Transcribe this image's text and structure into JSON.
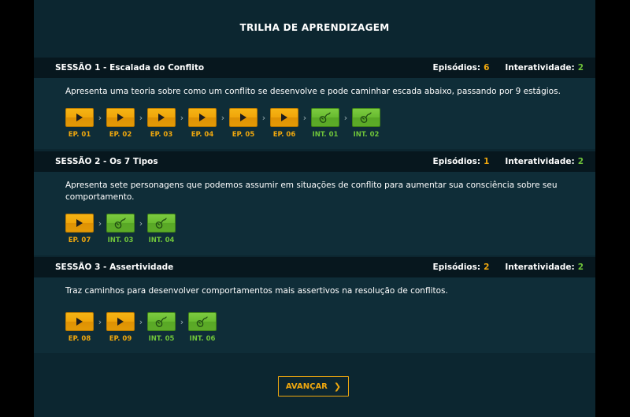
{
  "page": {
    "title": "TRILHA DE APRENDIZAGEM"
  },
  "colors": {
    "episode": "#f0a80e",
    "interactivity": "#6fc43a",
    "background": "#0c2630"
  },
  "icons": {
    "episode": "play-icon",
    "interactivity": "mouse-icon",
    "separator": "chevron-right-icon"
  },
  "sessions": [
    {
      "title": "SESSÃO 1 - Escalada do Conflito",
      "episodes_label": "Episódios:",
      "episodes_count": "6",
      "interactivity_label": "Interatividade:",
      "interactivity_count": "2",
      "description": "Apresenta uma teoria sobre como um conflito se desenvolve e pode caminhar escada abaixo, passando por 9 estágios.",
      "steps": [
        {
          "type": "ep",
          "label": "EP. 01"
        },
        {
          "type": "ep",
          "label": "EP. 02"
        },
        {
          "type": "ep",
          "label": "EP. 03"
        },
        {
          "type": "ep",
          "label": "EP. 04"
        },
        {
          "type": "ep",
          "label": "EP. 05"
        },
        {
          "type": "ep",
          "label": "EP. 06"
        },
        {
          "type": "int",
          "label": "INT. 01"
        },
        {
          "type": "int",
          "label": "INT. 02"
        }
      ]
    },
    {
      "title": "SESSÃO 2 - Os 7 Tipos",
      "episodes_label": "Episódios:",
      "episodes_count": "1",
      "interactivity_label": "Interatividade:",
      "interactivity_count": "2",
      "description": "Apresenta sete personagens que podemos assumir em situações de conflito para aumentar sua consciência sobre seu comportamento.",
      "steps": [
        {
          "type": "ep",
          "label": "EP. 07"
        },
        {
          "type": "int",
          "label": "INT. 03"
        },
        {
          "type": "int",
          "label": "INT. 04"
        }
      ]
    },
    {
      "title": "SESSÃO 3 - Assertividade",
      "episodes_label": "Episódios:",
      "episodes_count": "2",
      "interactivity_label": "Interatividade:",
      "interactivity_count": "2",
      "description": "Traz caminhos para desenvolver comportamentos mais assertivos na resolução de conflitos.",
      "steps": [
        {
          "type": "ep",
          "label": "EP. 08"
        },
        {
          "type": "ep",
          "label": "EP. 09"
        },
        {
          "type": "int",
          "label": "INT. 05"
        },
        {
          "type": "int",
          "label": "INT. 06"
        }
      ]
    }
  ],
  "advance_button": {
    "label": "AVANÇAR"
  }
}
